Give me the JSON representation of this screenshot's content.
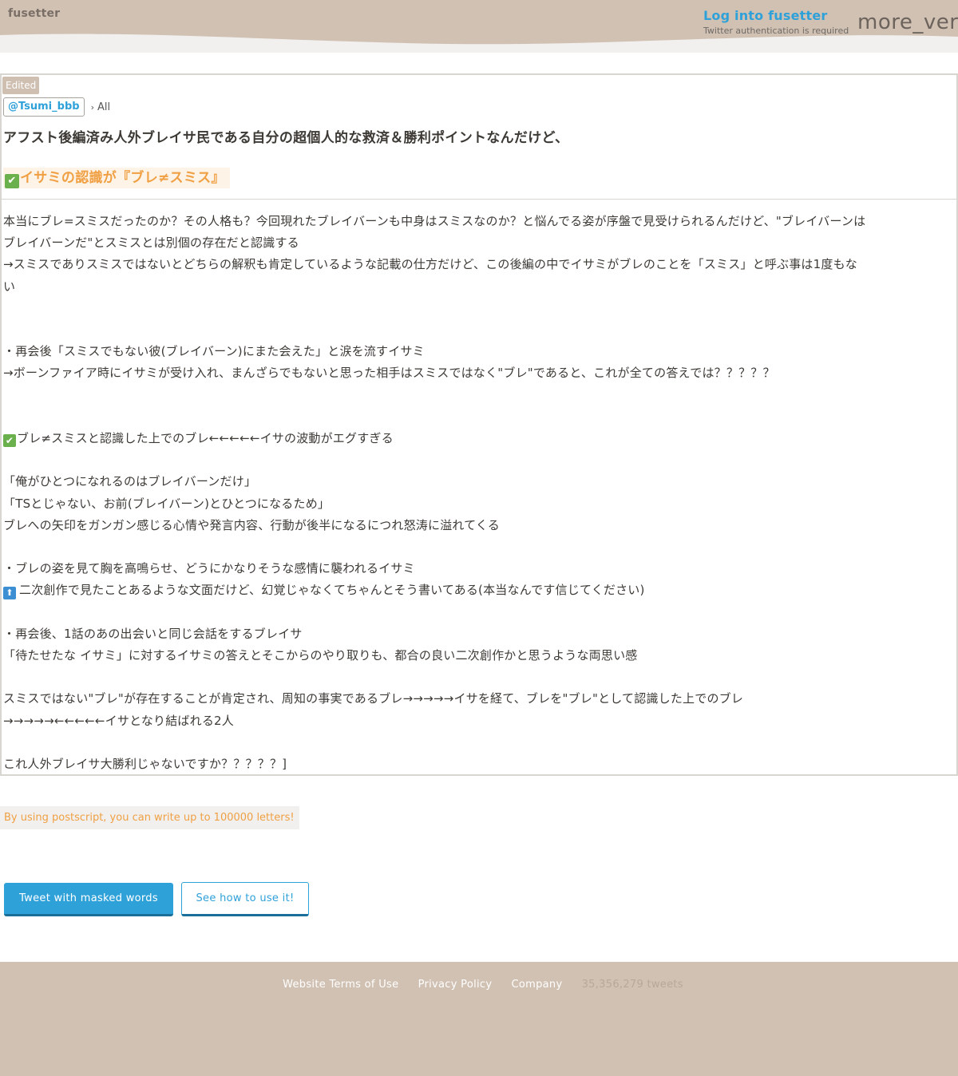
{
  "header": {
    "logo": "fusetter",
    "login_label": "Log into fusetter",
    "login_sub": "Twitter authentication is required",
    "menu_icon_text": "more_vert"
  },
  "post": {
    "edited_badge": "Edited",
    "user": "@Tsumi_bbb",
    "crumb_sep": "›",
    "crumb_all": "All",
    "title": "アフスト後編済み人外ブレイサ民である自分の超個人的な救済＆勝利ポイントなんだけど、",
    "highlight_icon": "✔",
    "highlight": "イサミの認識が『ブレ≠スミス』",
    "body": [
      {
        "text": "本当にブレ=スミスだったのか？その人格も？今回現れたブレイバーンも中身はスミスなのか？と悩んでる姿が序盤で見受けられるんだけど、\"ブレイバーンは"
      },
      {
        "text": "ブレイバーンだ\"とスミスとは別個の存在だと認識する"
      },
      {
        "text": "→スミスでありスミスではないとどちらの解釈も肯定しているような記載の仕方だけど、この後編の中でイサミがブレのことを「スミス」と呼ぶ事は1度もな"
      },
      {
        "text": "い"
      },
      {
        "text": ""
      },
      {
        "text": ""
      },
      {
        "text": "・再会後「スミスでもない彼(ブレイバーン)にまた会えた」と涙を流すイサミ"
      },
      {
        "text": "→ボーンファイア時にイサミが受け入れ、まんざらでもないと思った相手はスミスではなく\"ブレ\"であると、これが全ての答えでは？？？？？"
      },
      {
        "text": ""
      },
      {
        "text": ""
      },
      {
        "icon": "check",
        "icon_text": "✔",
        "text": "ブレ≠スミスと認識した上でのブレ←←←←←イサの波動がエグすぎる"
      },
      {
        "text": ""
      },
      {
        "text": "「俺がひとつになれるのはブレイバーンだけ」"
      },
      {
        "text": "「TSとじゃない、お前(ブレイバーン)とひとつになるため」"
      },
      {
        "text": "ブレへの矢印をガンガン感じる心情や発言内容、行動が後半になるにつれ怒涛に溢れてくる"
      },
      {
        "text": ""
      },
      {
        "text": "・ブレの姿を見て胸を高鳴らせ、どうにかなりそうな感情に襲われるイサミ"
      },
      {
        "icon": "up",
        "icon_text": "⬆",
        "text": "二次創作で見たことあるような文面だけど、幻覚じゃなくてちゃんとそう書いてある(本当なんです信じてください)"
      },
      {
        "text": ""
      },
      {
        "text": "・再会後、1話のあの出会いと同じ会話をするブレイサ"
      },
      {
        "text": "「待たせたな イサミ」に対するイサミの答えとそこからのやり取りも、都合の良い二次創作かと思うような両思い感"
      },
      {
        "text": ""
      },
      {
        "text": "スミスではない\"ブレ\"が存在することが肯定され、周知の事実であるブレ→→→→→イサを経て、ブレを\"ブレ\"として認識した上でのブレ"
      },
      {
        "text": "→→→→→←←←←←イサとなり結ばれる2人"
      },
      {
        "text": ""
      },
      {
        "text": "これ人外ブレイサ大勝利じゃないですか？？？？？]"
      }
    ]
  },
  "postscript_note": "By using postscript, you can write up to 100000 letters!",
  "buttons": {
    "tweet": "Tweet with masked words",
    "howto": "See how to use it!"
  },
  "footer": {
    "terms": "Website Terms of Use",
    "privacy": "Privacy Policy",
    "company": "Company",
    "count": "35,356,279 tweets"
  },
  "colors": {
    "header_wave": "#d1c1b3",
    "accent_blue": "#2fa1d9",
    "accent_orange": "#f0a043",
    "footer_bg": "#d1c1b3"
  }
}
